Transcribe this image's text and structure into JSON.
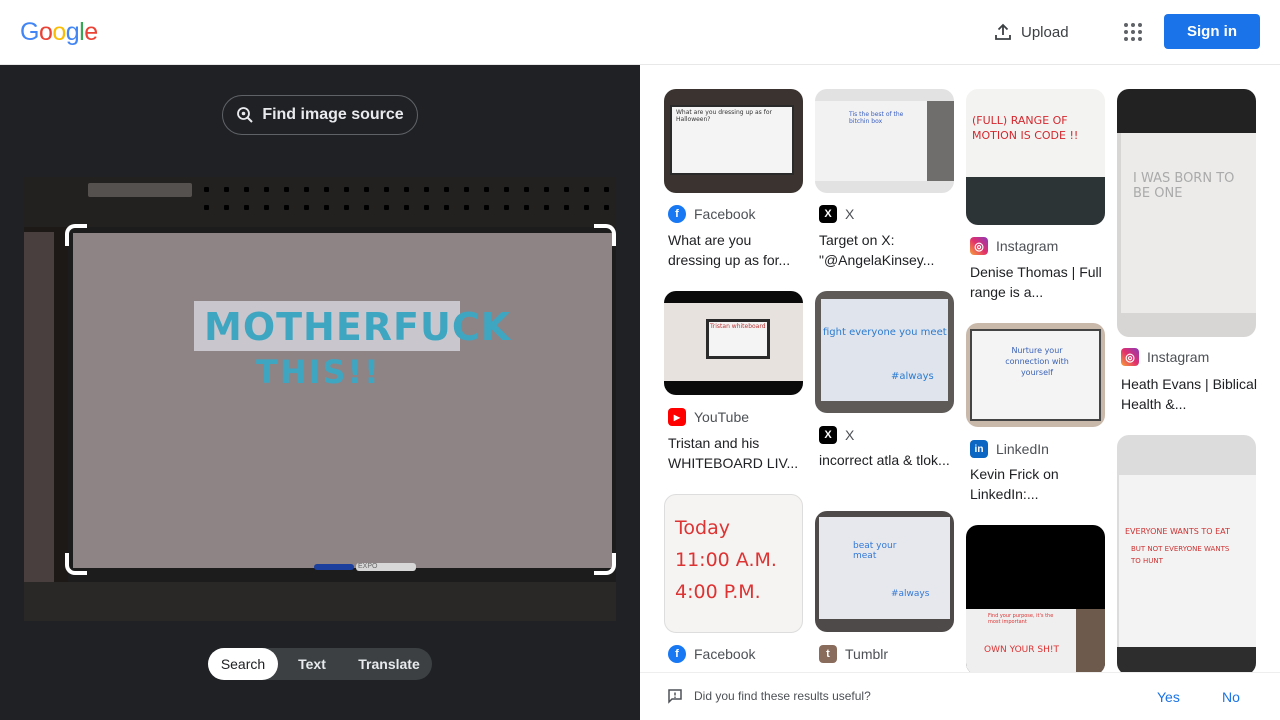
{
  "header": {
    "logo_letters": [
      "G",
      "o",
      "o",
      "g",
      "l",
      "e"
    ],
    "logo_colors": [
      "#4285f4",
      "#ea4335",
      "#fbbc05",
      "#4285f4",
      "#34a853",
      "#ea4335"
    ],
    "upload_label": "Upload",
    "signin_label": "Sign in",
    "accent_color": "#1a73e8"
  },
  "lens": {
    "find_source_label": "Find image source",
    "board_line1": "MOTHERFUCK",
    "board_line2": "THIS!!",
    "board_marker_label": "EXPO",
    "modes": [
      "Search",
      "Text",
      "Translate"
    ],
    "active_mode": "Search"
  },
  "results": [
    {
      "source": "Facebook",
      "source_icon": "facebook-icon",
      "title": "What are you dressing up as for...",
      "thumb_text": "What are you dressing up as for Halloween?"
    },
    {
      "source": "X",
      "source_icon": "x-icon",
      "title": "Target on X: \"@AngelaKinsey...",
      "thumb_text": "Tis the best of the bitchin box"
    },
    {
      "source": "Instagram",
      "source_icon": "instagram-icon",
      "title": "Denise Thomas | Full range is a...",
      "thumb_text": "(FULL) RANGE OF MOTION IS CODE !!"
    },
    {
      "source": "Instagram",
      "source_icon": "instagram-icon",
      "title": "Heath Evans | Biblical Health &...",
      "thumb_text": "I WAS BORN TO BE ONE"
    },
    {
      "source": "YouTube",
      "source_icon": "youtube-icon",
      "title": "Tristan and his WHITEBOARD LIV...",
      "thumb_text": "Tristan whiteboard"
    },
    {
      "source": "X",
      "source_icon": "x-icon",
      "title": "incorrect atla & tlok...",
      "thumb_text": "fight everyone you meet",
      "thumb_text2": "#always"
    },
    {
      "source": "LinkedIn",
      "source_icon": "linkedin-icon",
      "title": "Kevin Frick on LinkedIn:...",
      "thumb_text": "Nurture your connection with yourself"
    },
    {
      "source": "Facebook",
      "source_icon": "facebook-icon",
      "title": "",
      "thumb_text": "Today",
      "thumb_text2": "11:00 A.M.",
      "thumb_text3": "4:00 P.M."
    },
    {
      "source": "Tumblr",
      "source_icon": "tumblr-icon",
      "title": "",
      "thumb_text": "beat your meat",
      "thumb_text2": "#always"
    },
    {
      "source": "",
      "source_icon": "",
      "title": "",
      "thumb_text": "Find your purpose, it's the most important",
      "thumb_text2": "OWN YOUR SH!T"
    },
    {
      "source": "",
      "source_icon": "",
      "title": "",
      "thumb_text": "EVERYONE WANTS TO EAT",
      "thumb_text2": "BUT NOT EVERYONE WANTS TO HUNT"
    }
  ],
  "feedback": {
    "question": "Did you find these results useful?",
    "yes_label": "Yes",
    "no_label": "No"
  }
}
